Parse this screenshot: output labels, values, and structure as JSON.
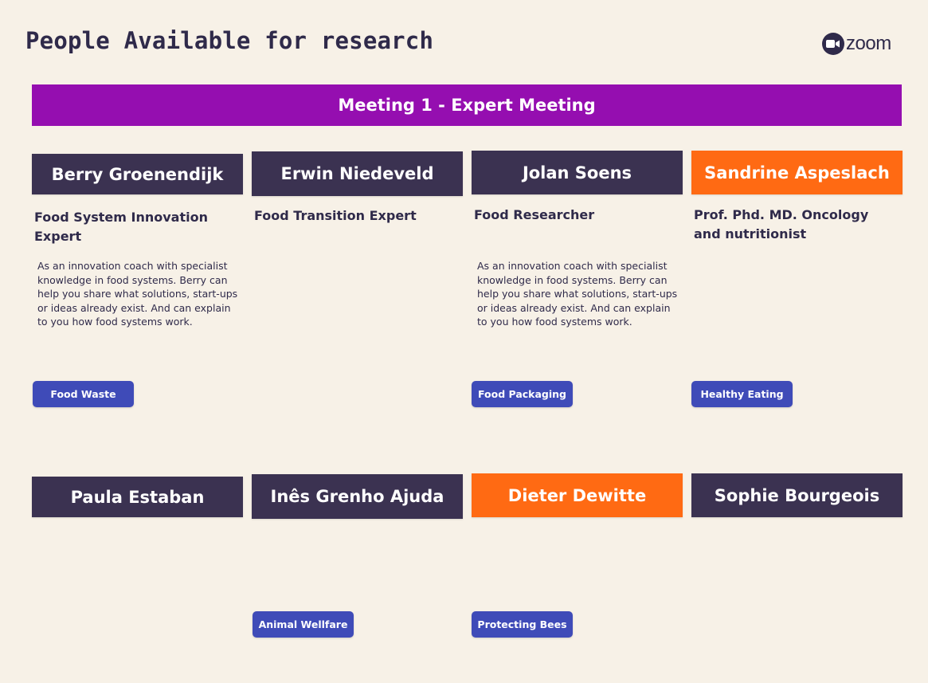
{
  "page": {
    "title": "People Available for research"
  },
  "logo": {
    "text": "zoom",
    "icon": "video-camera-icon"
  },
  "meeting": {
    "title": "Meeting 1 - Expert Meeting",
    "color": "#950eb0"
  },
  "colors": {
    "header": "#3b3251",
    "highlight": "#ff6a13",
    "tag": "#3f4bb8",
    "background": "#f7f1e7"
  },
  "people": [
    {
      "name": "Berry Groenendijk",
      "role": "Food System Innovation Expert",
      "description": "As an innovation coach with specialist knowledge in food systems. Berry can help you share what solutions, start-ups or ideas already exist. And can explain to you how food systems work.",
      "tag": "Food Waste"
    },
    {
      "name": "Erwin Niedeveld",
      "role": "Food Transition Expert"
    },
    {
      "name": "Jolan Soens",
      "role": "Food Researcher",
      "description": "As an innovation coach with specialist knowledge in food systems. Berry can help you share what solutions, start-ups or ideas already exist. And can explain to you how food systems work.",
      "tag": "Food Packaging"
    },
    {
      "name": "Sandrine Aspeslach",
      "role": "Prof. Phd. MD. Oncology and nutritionist",
      "tag": "Healthy Eating"
    },
    {
      "name": "Paula Estaban"
    },
    {
      "name": "Inês Grenho Ajuda",
      "tag": "Animal Wellfare"
    },
    {
      "name": "Dieter Dewitte",
      "tag": "Protecting Bees"
    },
    {
      "name": "Sophie Bourgeois"
    }
  ]
}
